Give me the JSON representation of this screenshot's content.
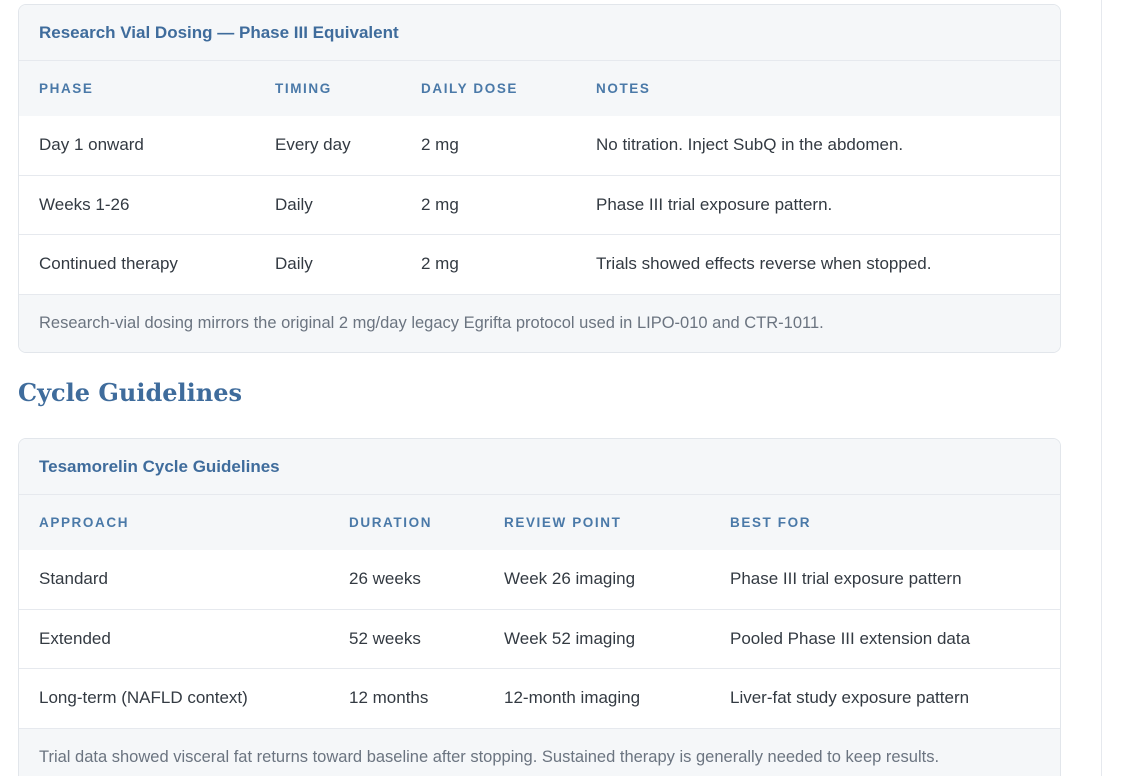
{
  "dosing_table": {
    "title": "Research Vial Dosing — Phase III Equivalent",
    "columns": [
      "PHASE",
      "TIMING",
      "DAILY DOSE",
      "NOTES"
    ],
    "rows": [
      [
        "Day 1 onward",
        "Every day",
        "2 mg",
        "No titration. Inject SubQ in the abdomen."
      ],
      [
        "Weeks 1-26",
        "Daily",
        "2 mg",
        "Phase III trial exposure pattern."
      ],
      [
        "Continued therapy",
        "Daily",
        "2 mg",
        "Trials showed effects reverse when stopped."
      ]
    ],
    "footnote": "Research-vial dosing mirrors the original 2 mg/day legacy Egrifta protocol used in LIPO-010 and CTR-1011."
  },
  "section": {
    "title": "Cycle Guidelines"
  },
  "cycle_table": {
    "title": "Tesamorelin Cycle Guidelines",
    "columns": [
      "APPROACH",
      "DURATION",
      "REVIEW POINT",
      "BEST FOR"
    ],
    "rows": [
      [
        "Standard",
        "26 weeks",
        "Week 26 imaging",
        "Phase III trial exposure pattern"
      ],
      [
        "Extended",
        "52 weeks",
        "Week 52 imaging",
        "Pooled Phase III extension data"
      ],
      [
        "Long-term (NAFLD context)",
        "12 months",
        "12-month imaging",
        "Liver-fat study exposure pattern"
      ]
    ],
    "footnote": "Trial data showed visceral fat returns toward baseline after stopping. Sustained therapy is generally needed to keep results."
  }
}
